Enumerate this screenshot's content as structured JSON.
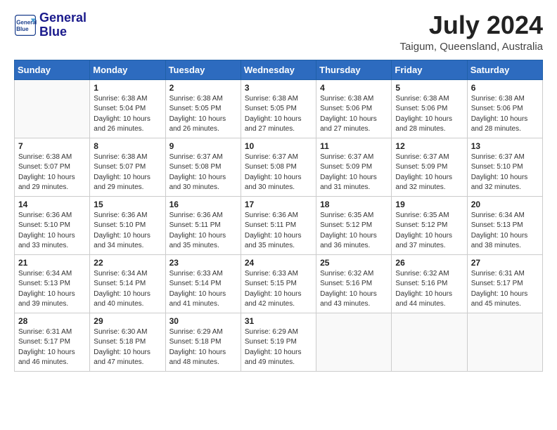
{
  "header": {
    "logo_line1": "General",
    "logo_line2": "Blue",
    "month_year": "July 2024",
    "location": "Taigum, Queensland, Australia"
  },
  "days_of_week": [
    "Sunday",
    "Monday",
    "Tuesday",
    "Wednesday",
    "Thursday",
    "Friday",
    "Saturday"
  ],
  "weeks": [
    [
      {
        "day": "",
        "info": ""
      },
      {
        "day": "1",
        "info": "Sunrise: 6:38 AM\nSunset: 5:04 PM\nDaylight: 10 hours\nand 26 minutes."
      },
      {
        "day": "2",
        "info": "Sunrise: 6:38 AM\nSunset: 5:05 PM\nDaylight: 10 hours\nand 26 minutes."
      },
      {
        "day": "3",
        "info": "Sunrise: 6:38 AM\nSunset: 5:05 PM\nDaylight: 10 hours\nand 27 minutes."
      },
      {
        "day": "4",
        "info": "Sunrise: 6:38 AM\nSunset: 5:06 PM\nDaylight: 10 hours\nand 27 minutes."
      },
      {
        "day": "5",
        "info": "Sunrise: 6:38 AM\nSunset: 5:06 PM\nDaylight: 10 hours\nand 28 minutes."
      },
      {
        "day": "6",
        "info": "Sunrise: 6:38 AM\nSunset: 5:06 PM\nDaylight: 10 hours\nand 28 minutes."
      }
    ],
    [
      {
        "day": "7",
        "info": "Sunrise: 6:38 AM\nSunset: 5:07 PM\nDaylight: 10 hours\nand 29 minutes."
      },
      {
        "day": "8",
        "info": "Sunrise: 6:38 AM\nSunset: 5:07 PM\nDaylight: 10 hours\nand 29 minutes."
      },
      {
        "day": "9",
        "info": "Sunrise: 6:37 AM\nSunset: 5:08 PM\nDaylight: 10 hours\nand 30 minutes."
      },
      {
        "day": "10",
        "info": "Sunrise: 6:37 AM\nSunset: 5:08 PM\nDaylight: 10 hours\nand 30 minutes."
      },
      {
        "day": "11",
        "info": "Sunrise: 6:37 AM\nSunset: 5:09 PM\nDaylight: 10 hours\nand 31 minutes."
      },
      {
        "day": "12",
        "info": "Sunrise: 6:37 AM\nSunset: 5:09 PM\nDaylight: 10 hours\nand 32 minutes."
      },
      {
        "day": "13",
        "info": "Sunrise: 6:37 AM\nSunset: 5:10 PM\nDaylight: 10 hours\nand 32 minutes."
      }
    ],
    [
      {
        "day": "14",
        "info": "Sunrise: 6:36 AM\nSunset: 5:10 PM\nDaylight: 10 hours\nand 33 minutes."
      },
      {
        "day": "15",
        "info": "Sunrise: 6:36 AM\nSunset: 5:10 PM\nDaylight: 10 hours\nand 34 minutes."
      },
      {
        "day": "16",
        "info": "Sunrise: 6:36 AM\nSunset: 5:11 PM\nDaylight: 10 hours\nand 35 minutes."
      },
      {
        "day": "17",
        "info": "Sunrise: 6:36 AM\nSunset: 5:11 PM\nDaylight: 10 hours\nand 35 minutes."
      },
      {
        "day": "18",
        "info": "Sunrise: 6:35 AM\nSunset: 5:12 PM\nDaylight: 10 hours\nand 36 minutes."
      },
      {
        "day": "19",
        "info": "Sunrise: 6:35 AM\nSunset: 5:12 PM\nDaylight: 10 hours\nand 37 minutes."
      },
      {
        "day": "20",
        "info": "Sunrise: 6:34 AM\nSunset: 5:13 PM\nDaylight: 10 hours\nand 38 minutes."
      }
    ],
    [
      {
        "day": "21",
        "info": "Sunrise: 6:34 AM\nSunset: 5:13 PM\nDaylight: 10 hours\nand 39 minutes."
      },
      {
        "day": "22",
        "info": "Sunrise: 6:34 AM\nSunset: 5:14 PM\nDaylight: 10 hours\nand 40 minutes."
      },
      {
        "day": "23",
        "info": "Sunrise: 6:33 AM\nSunset: 5:14 PM\nDaylight: 10 hours\nand 41 minutes."
      },
      {
        "day": "24",
        "info": "Sunrise: 6:33 AM\nSunset: 5:15 PM\nDaylight: 10 hours\nand 42 minutes."
      },
      {
        "day": "25",
        "info": "Sunrise: 6:32 AM\nSunset: 5:16 PM\nDaylight: 10 hours\nand 43 minutes."
      },
      {
        "day": "26",
        "info": "Sunrise: 6:32 AM\nSunset: 5:16 PM\nDaylight: 10 hours\nand 44 minutes."
      },
      {
        "day": "27",
        "info": "Sunrise: 6:31 AM\nSunset: 5:17 PM\nDaylight: 10 hours\nand 45 minutes."
      }
    ],
    [
      {
        "day": "28",
        "info": "Sunrise: 6:31 AM\nSunset: 5:17 PM\nDaylight: 10 hours\nand 46 minutes."
      },
      {
        "day": "29",
        "info": "Sunrise: 6:30 AM\nSunset: 5:18 PM\nDaylight: 10 hours\nand 47 minutes."
      },
      {
        "day": "30",
        "info": "Sunrise: 6:29 AM\nSunset: 5:18 PM\nDaylight: 10 hours\nand 48 minutes."
      },
      {
        "day": "31",
        "info": "Sunrise: 6:29 AM\nSunset: 5:19 PM\nDaylight: 10 hours\nand 49 minutes."
      },
      {
        "day": "",
        "info": ""
      },
      {
        "day": "",
        "info": ""
      },
      {
        "day": "",
        "info": ""
      }
    ]
  ]
}
